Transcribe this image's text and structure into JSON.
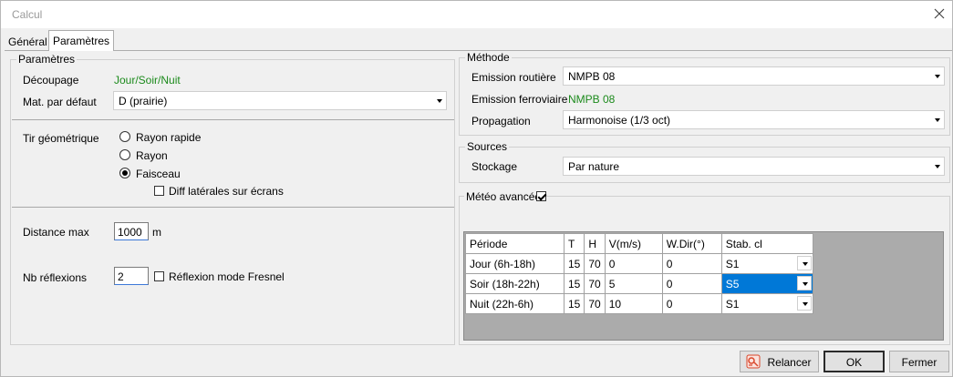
{
  "window": {
    "title": "Calcul"
  },
  "tabs": [
    {
      "label": "Général"
    },
    {
      "label": "Paramètres"
    }
  ],
  "parametres": {
    "group_title": "Paramètres",
    "decoupage_label": "Découpage",
    "decoupage_value": "Jour/Soir/Nuit",
    "mat_label": "Mat. par défaut",
    "mat_value": "D (prairie)",
    "tir_label": "Tir géométrique",
    "tir_options": [
      {
        "label": "Rayon rapide",
        "selected": false
      },
      {
        "label": "Rayon",
        "selected": false
      },
      {
        "label": "Faisceau",
        "selected": true
      }
    ],
    "diff_label": "Diff latérales sur écrans",
    "diff_checked": false,
    "distance_label": "Distance max",
    "distance_value": "1000",
    "distance_unit": "m",
    "nb_label": "Nb réflexions",
    "nb_value": "2",
    "fresnel_label": "Réflexion mode Fresnel",
    "fresnel_checked": false
  },
  "methode": {
    "group_title": "Méthode",
    "emission_routiere_label": "Emission routière",
    "emission_routiere_value": "NMPB 08",
    "emission_ferroviaire_label": "Emission ferroviaire",
    "emission_ferroviaire_value": "NMPB 08",
    "propagation_label": "Propagation",
    "propagation_value": "Harmonoise (1/3 oct)"
  },
  "sources": {
    "group_title": "Sources",
    "stockage_label": "Stockage",
    "stockage_value": "Par nature"
  },
  "meteo": {
    "group_title": "Météo avancée",
    "checked": true,
    "columns": [
      "Période",
      "T",
      "H",
      "V(m/s)",
      "W.Dir(°)",
      "Stab. cl"
    ],
    "rows": [
      {
        "periode": "Jour (6h-18h)",
        "t": "15",
        "h": "70",
        "v": "0",
        "wdir": "0",
        "stab": "S1",
        "selected": false
      },
      {
        "periode": "Soir (18h-22h)",
        "t": "15",
        "h": "70",
        "v": "5",
        "wdir": "0",
        "stab": "S5",
        "selected": true
      },
      {
        "periode": "Nuit (22h-6h)",
        "t": "15",
        "h": "70",
        "v": "10",
        "wdir": "0",
        "stab": "S1",
        "selected": false
      }
    ]
  },
  "buttons": {
    "relancer": "Relancer",
    "ok": "OK",
    "fermer": "Fermer"
  },
  "colors": {
    "accent": "#0078d7",
    "green_value": "#1b8a1b",
    "relancer_icon": "#d9462b"
  }
}
